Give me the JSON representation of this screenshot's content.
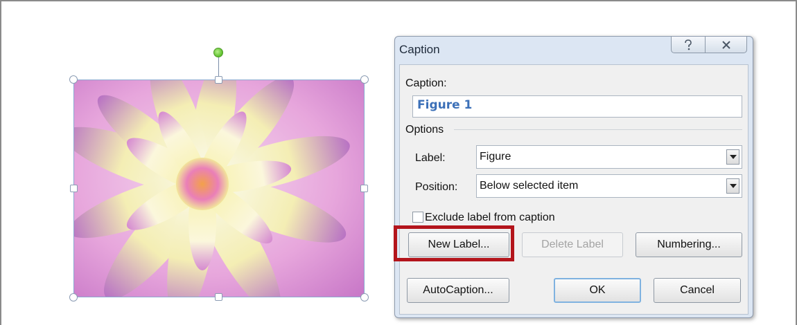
{
  "dialog": {
    "title": "Caption",
    "caption_label": "Caption:",
    "caption_value": "Figure 1",
    "options_label": "Options",
    "label_label": "Label:",
    "label_value": "Figure",
    "position_label": "Position:",
    "position_value": "Below selected item",
    "exclude_label": "Exclude label from caption",
    "exclude_checked": false,
    "buttons": {
      "new_label": "New Label...",
      "delete_label": "Delete Label",
      "numbering": "Numbering...",
      "autocaption": "AutoCaption...",
      "ok": "OK",
      "cancel": "Cancel"
    }
  },
  "icons": {
    "help": "help-icon",
    "close": "close-icon"
  },
  "colors": {
    "highlight": "#b3141b",
    "caption_text": "#3c70b8"
  }
}
